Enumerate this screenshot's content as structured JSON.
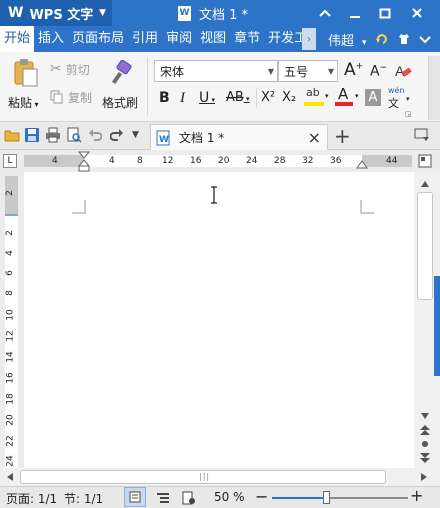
{
  "app": {
    "logo": "W",
    "name": "WPS 文字",
    "doc_title": "文档 1 *",
    "doc_icon_letter": "W"
  },
  "window": {
    "collapse_icon": "chevron-up",
    "minimize_icon": "minimize",
    "maximize_icon": "maximize",
    "close_icon": "close"
  },
  "menu": {
    "items": [
      "开始",
      "插入",
      "页面布局",
      "引用",
      "审阅",
      "视图",
      "章节",
      "开发工"
    ],
    "more_arrow": "›",
    "user": "伟超",
    "user_arrow": "▾"
  },
  "ribbon": {
    "paste": "粘贴",
    "cut": "剪切",
    "copy": "复制",
    "format_painter": "格式刷",
    "font_name": "宋体",
    "font_size": "五号",
    "grow_font": "A",
    "shrink_font": "A",
    "bold": "B",
    "italic": "I",
    "underline": "U",
    "strike": "AB",
    "superscript": "X²",
    "subscript": "X₂",
    "highlight": "ab",
    "font_color": "A",
    "char_shading": "A",
    "pinyin_top": "wén",
    "pinyin_bottom": "文"
  },
  "tab": {
    "title": "文档 1 *",
    "close": "×",
    "add": "+"
  },
  "ruler": {
    "h_ticks": [
      "4",
      "4",
      "8",
      "12",
      "16",
      "20",
      "24",
      "28",
      "32",
      "36",
      "44"
    ],
    "v_ticks": [
      "2",
      "2",
      "4",
      "6",
      "8",
      "10",
      "12",
      "14",
      "16",
      "18",
      "20",
      "22",
      "24"
    ],
    "corner": "L"
  },
  "status": {
    "page": "页面: 1/1",
    "section": "节: 1/1",
    "zoom": "50 %",
    "zoom_minus": "−",
    "zoom_plus": "+",
    "zoom_level": 0.4
  },
  "colors": {
    "title_bar": "#2d73c8",
    "accent": "#1e5fae"
  }
}
